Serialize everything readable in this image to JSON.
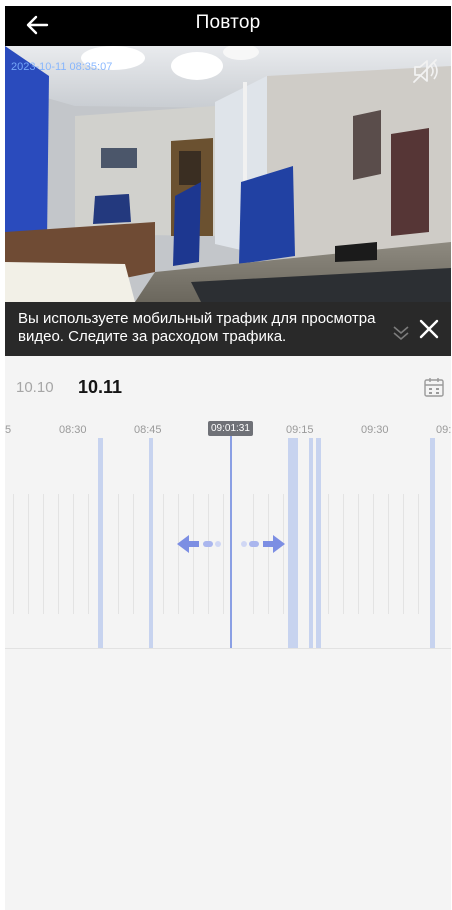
{
  "header": {
    "title": "Повтор",
    "back_icon": "arrow-left-icon"
  },
  "video": {
    "timestamp": "2023-10-11 08:35:07",
    "mute_icon": "speaker-muted-icon"
  },
  "banner": {
    "text": "Вы используете мобильный трафик для просмотра видео. Следите за расходом трафика.",
    "close_icon": "close-icon",
    "collapse_icon": "chevron-double-down-icon"
  },
  "dates": {
    "prev": "10.10",
    "current": "10.11",
    "calendar_icon": "calendar-icon"
  },
  "timeline": {
    "current_time": "09:01:31",
    "ticks": [
      "5",
      "08:30",
      "08:45",
      "09:15",
      "09:30",
      "09:"
    ],
    "accent": "#7c8ee3",
    "drag_icon": "drag-left-right-icon"
  }
}
